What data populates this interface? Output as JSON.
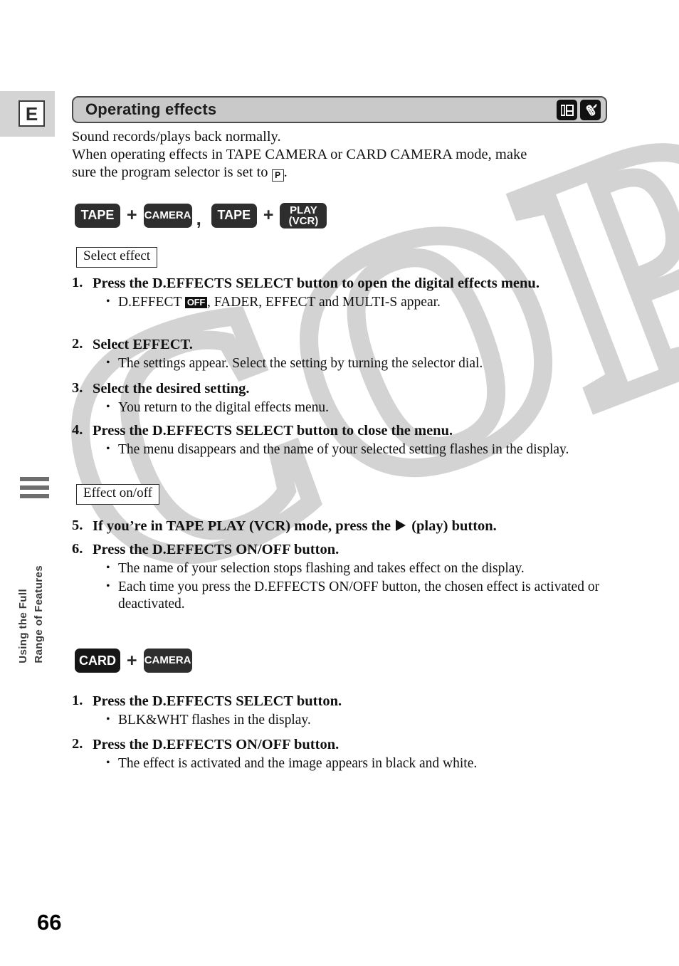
{
  "page": {
    "number": "66",
    "language_badge": "E",
    "watermark_text": "COPY",
    "side_tab_label_line1": "Using the Full",
    "side_tab_label_line2": "Range of Features"
  },
  "header": {
    "title": "Operating effects",
    "icons": [
      {
        "name": "camcorder-lcd-icon",
        "label": "camcorder"
      },
      {
        "name": "remote-control-icon",
        "label": "wireless remote"
      }
    ]
  },
  "intro": {
    "line1": "Sound records/plays back normally.",
    "line2": "When operating effects in TAPE CAMERA or CARD CAMERA mode, make",
    "line3_prefix": "sure the program selector is set to ",
    "program_symbol": "P",
    "line3_suffix": "."
  },
  "mode_row_1": {
    "chips": [
      {
        "label": "TAPE"
      },
      {
        "label": "CAMERA"
      },
      {
        "label": "TAPE"
      },
      {
        "label_line1": "PLAY",
        "label_line2": "(VCR)"
      }
    ],
    "plus": "+",
    "comma": ","
  },
  "mode_row_2": {
    "chips": [
      {
        "label": "CARD"
      },
      {
        "label": "CAMERA"
      }
    ],
    "plus": "+"
  },
  "sections": [
    {
      "box_label": "Select effect"
    },
    {
      "box_label": "Effect on/off"
    }
  ],
  "steps": {
    "s1": {
      "num": "1.",
      "title": "Press the D.EFFECTS SELECT button to open the digital effects menu.",
      "bullet_prefix": "D.EFFECT ",
      "bullet_badge": "OFF",
      "bullet_suffix": ", FADER, EFFECT and MULTI-S appear."
    },
    "s2": {
      "num": "2.",
      "title": "Select EFFECT.",
      "bullet": "The settings appear.  Select the setting by turning the selector dial."
    },
    "s3": {
      "num": "3.",
      "title": "Select the desired setting.",
      "bullet": "You return to the digital effects menu."
    },
    "s4": {
      "num": "4.",
      "title": "Press the D.EFFECTS SELECT button to close the menu.",
      "bullet": "The menu disappears and the name of your selected setting flashes in the display."
    },
    "s5": {
      "num": "5.",
      "title_prefix": "If you’re in TAPE PLAY (VCR) mode, press the ",
      "title_suffix": " (play) button."
    },
    "s6": {
      "num": "6.",
      "title": "Press the D.EFFECTS ON/OFF button.",
      "bullet1": "The name of your selection stops flashing and takes effect on the display.",
      "bullet2": "Each time you press the D.EFFECTS ON/OFF button, the chosen effect is activated or deactivated."
    },
    "s7": {
      "num": "1.",
      "title": "Press the D.EFFECTS SELECT button.",
      "bullet": "BLK&WHT flashes in the display."
    },
    "s8": {
      "num": "2.",
      "title": "Press the D.EFFECTS ON/OFF button.",
      "bullet": "The effect is activated and the image appears in black and white."
    }
  },
  "colors": {
    "header_bg": "#c9c9c9",
    "header_border": "#4a4a4a",
    "chip_bg": "#2e2e2e",
    "watermark": "#d3d3d3",
    "side_bar": "#6e6e6e",
    "e_block_bg": "#d4d4d4"
  }
}
